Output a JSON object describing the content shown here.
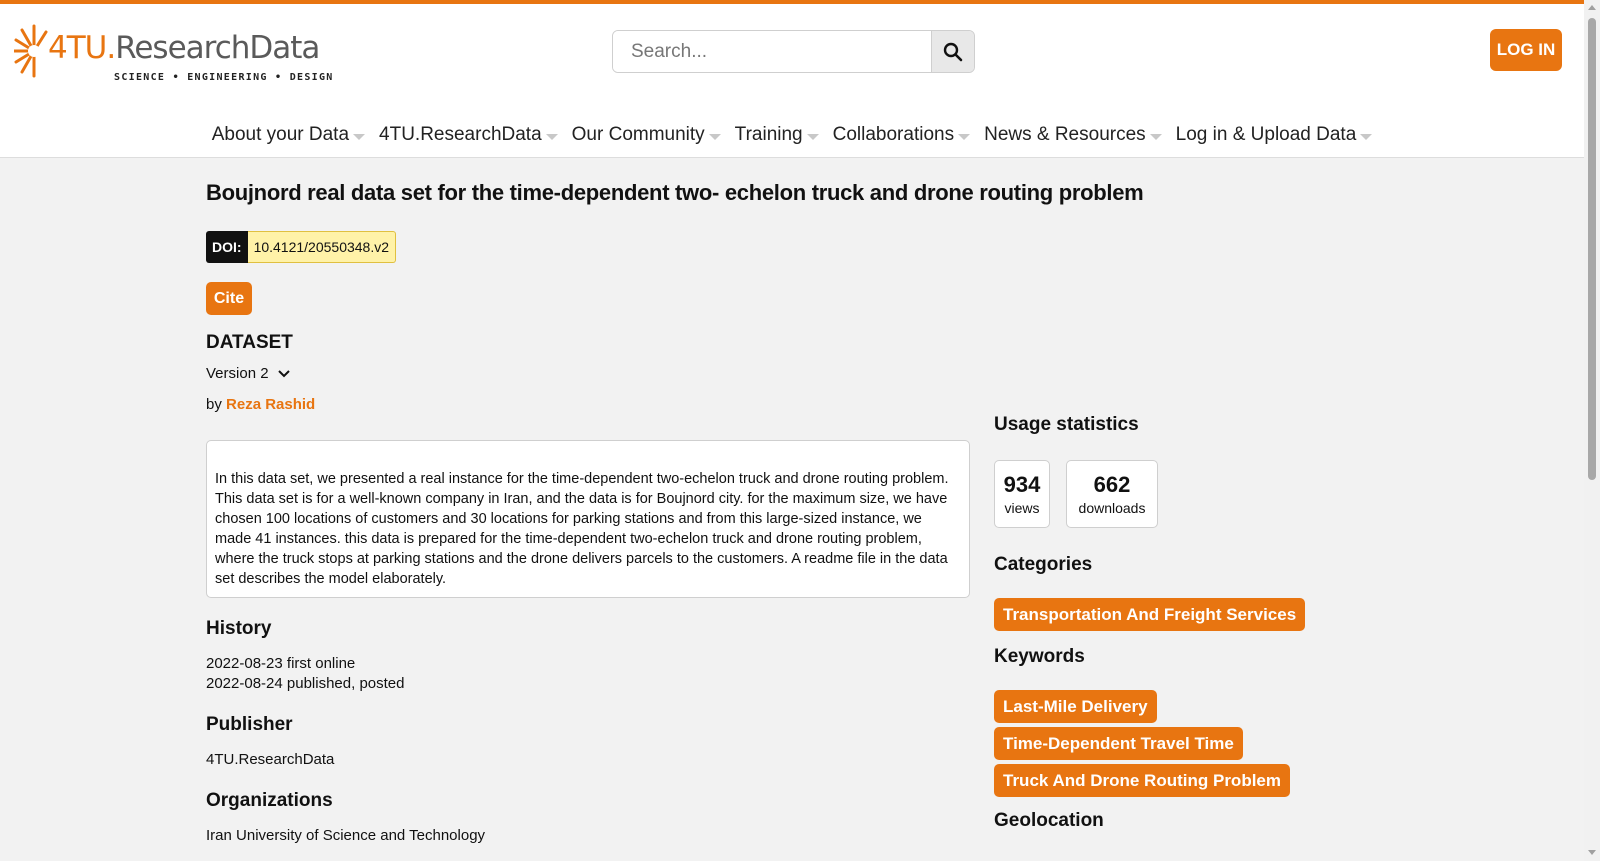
{
  "header": {
    "logo_main": "4TU.",
    "logo_sub": "ResearchData",
    "logo_tagline": "SCIENCE • ENGINEERING • DESIGN",
    "search_placeholder": "Search...",
    "login_label": "LOG IN",
    "accent_color": "#e87511",
    "icons": {
      "search": "magnifier-icon",
      "logo": "sunburst-logo-icon",
      "nav_caret": "caret-down-icon"
    }
  },
  "nav": {
    "items": [
      "About your Data",
      "4TU.ResearchData",
      "Our Community",
      "Training",
      "Collaborations",
      "News & Resources",
      "Log in & Upload Data"
    ]
  },
  "dataset": {
    "title": "Boujnord real data set for the time-dependent two- echelon truck and drone routing problem",
    "doi_label": "DOI:",
    "doi_value": "10.4121/20550348.v2",
    "cite_label": "Cite",
    "type_label": "DATASET",
    "version_label": "Version 2",
    "by_prefix": "by",
    "author": "Reza Rashid",
    "description": "In this data set, we presented a real instance for the time-dependent two-echelon truck and drone routing problem. This data set is for a well-known company in Iran, and the data is for Boujnord city. for the maximum size, we have chosen 100 locations of customers and 30 locations for parking stations and from this large-sized instance, we made 41 instances. this data is prepared for the time-dependent two-echelon truck and drone routing problem, where the truck stops at parking stations and the drone delivers parcels to the customers. A readme file in the data set describes the model elaborately.",
    "history_heading": "History",
    "history": [
      "2022-08-23 first online",
      "2022-08-24 published, posted"
    ],
    "publisher_heading": "Publisher",
    "publisher": "4TU.ResearchData",
    "organizations_heading": "Organizations",
    "organizations": "Iran University of Science and Technology"
  },
  "sidebar": {
    "usage_heading": "Usage statistics",
    "views_count": "934",
    "views_label": "views",
    "downloads_count": "662",
    "downloads_label": "downloads",
    "categories_heading": "Categories",
    "categories": [
      "Transportation And Freight Services"
    ],
    "keywords_heading": "Keywords",
    "keywords": [
      "Last-Mile Delivery",
      "Time-Dependent Travel Time",
      "Truck And Drone Routing Problem"
    ],
    "geolocation_heading": "Geolocation"
  }
}
